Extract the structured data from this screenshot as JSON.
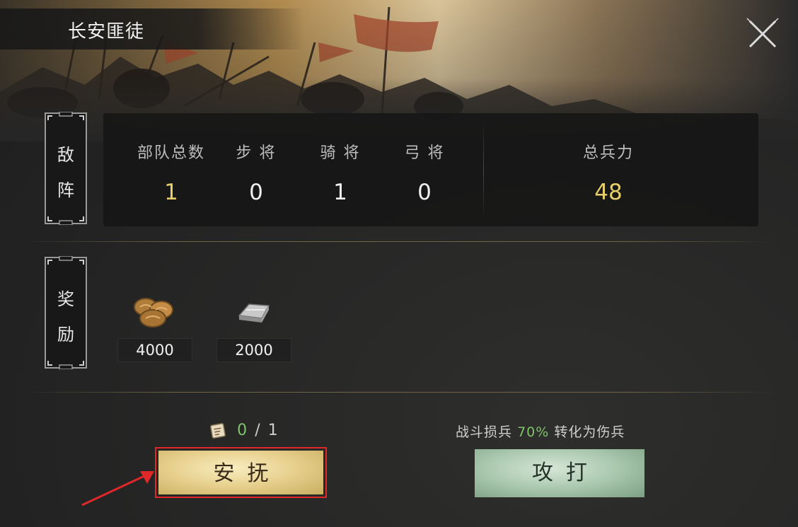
{
  "title": "长安匪徒",
  "enemy": {
    "tag_chars": [
      "敌",
      "阵"
    ],
    "stats": [
      {
        "label": "部队总数",
        "value": "1"
      },
      {
        "label": "步 将",
        "value": "0"
      },
      {
        "label": "骑 将",
        "value": "1"
      },
      {
        "label": "弓 将",
        "value": "0"
      }
    ],
    "total_power": {
      "label": "总兵力",
      "value": "48"
    }
  },
  "rewards": {
    "tag_chars": [
      "奖",
      "励"
    ],
    "items": [
      {
        "icon": "grain-sacks-icon",
        "amount": "4000"
      },
      {
        "icon": "silver-ingot-icon",
        "amount": "2000"
      }
    ]
  },
  "pacify": {
    "tokens_used": "0",
    "separator": "/",
    "tokens_total": "1",
    "button_label": "安抚"
  },
  "attack": {
    "loss_prefix": "战斗损兵",
    "loss_percent": "70%",
    "loss_suffix": "转化为伤兵",
    "button_label": "攻打"
  },
  "colors": {
    "gold_value": "#e6cf6a",
    "green_value": "#7fc36b",
    "pacify_button": "#e6cf8c",
    "attack_button": "#a9c8ae",
    "highlight_border": "#e0282a"
  }
}
